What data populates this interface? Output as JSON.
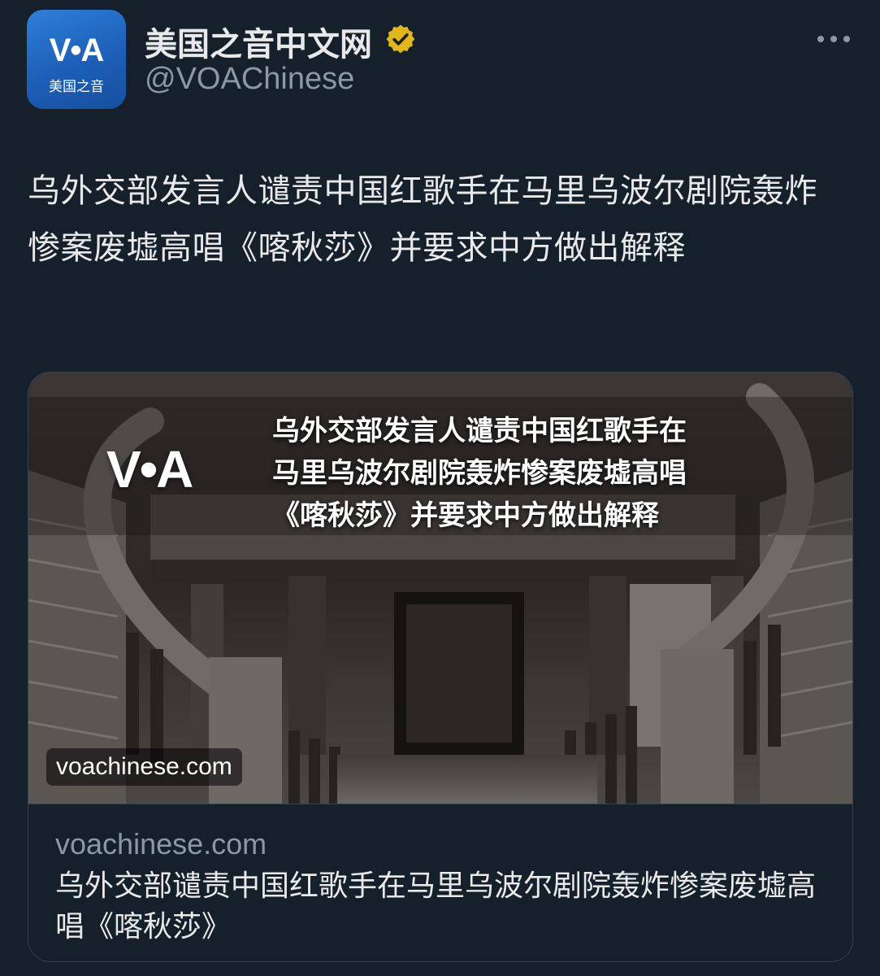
{
  "author": {
    "avatar_logo": "V•A",
    "avatar_sub": "美国之音",
    "display_name": "美国之音中文网",
    "handle": "@VOAChinese",
    "verified": true,
    "verified_color": "#e2b719"
  },
  "tweet": {
    "text": "乌外交部发言人谴责中国红歌手在马里乌波尔剧院轰炸惨案废墟高唱《喀秋莎》并要求中方做出解释"
  },
  "card": {
    "image": {
      "logo": "V•A",
      "headline_lines": [
        "乌外交部发言人谴责中国红歌手在",
        "马里乌波尔剧院轰炸惨案废墟高唱",
        "《喀秋莎》并要求中方做出解释"
      ],
      "domain_badge": "voachinese.com"
    },
    "domain": "voachinese.com",
    "title": "乌外交部谴责中国红歌手在马里乌波尔剧院轰炸惨案废墟高唱《喀秋莎》"
  },
  "colors": {
    "background": "#15202b",
    "text_primary": "#e7e9ea",
    "text_secondary": "#8b98a5",
    "border": "#38444d",
    "avatar_blue": "#1c5fb8"
  },
  "icons": {
    "verified": "verified-badge-icon",
    "more": "more-dots-icon"
  }
}
